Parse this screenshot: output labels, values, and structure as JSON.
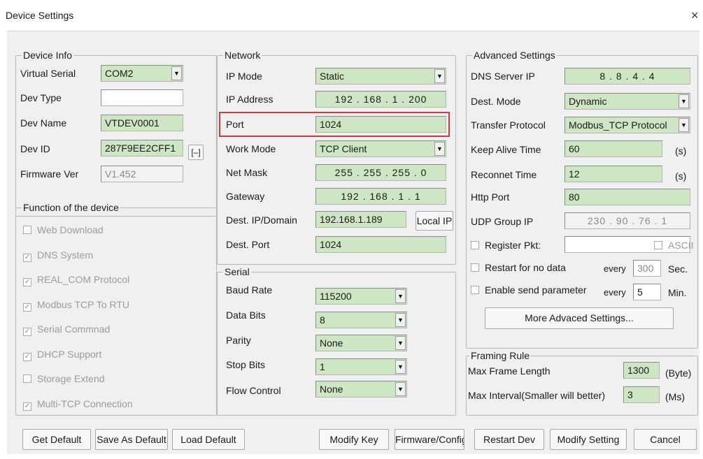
{
  "window": {
    "title": "Device Settings",
    "close_glyph": "×"
  },
  "device_info": {
    "legend": "Device Info",
    "virtual_serial_label": "Virtual Serial",
    "virtual_serial_value": "COM2",
    "dev_type_label": "Dev Type",
    "dev_type_value": "",
    "dev_name_label": "Dev Name",
    "dev_name_value": "VTDEV0001",
    "dev_id_label": "Dev ID",
    "dev_id_value": "287F9EE2CFF1",
    "dev_id_button": "[–]",
    "firmware_label": "Firmware Ver",
    "firmware_value": "V1.452"
  },
  "functions": {
    "legend": "Function of the device",
    "items": [
      {
        "label": "Web Download",
        "checked": false
      },
      {
        "label": "DNS System",
        "checked": true
      },
      {
        "label": "REAL_COM Protocol",
        "checked": true
      },
      {
        "label": "Modbus TCP To RTU",
        "checked": true
      },
      {
        "label": "Serial Commnad",
        "checked": true
      },
      {
        "label": "DHCP Support",
        "checked": true
      },
      {
        "label": "Storage Extend",
        "checked": false
      },
      {
        "label": "Multi-TCP Connection",
        "checked": true
      }
    ]
  },
  "network": {
    "legend": "Network",
    "ip_mode_label": "IP Mode",
    "ip_mode_value": "Static",
    "ip_address_label": "IP Address",
    "ip_address_value": "192 . 168 .  1  . 200",
    "port_label": "Port",
    "port_value": "1024",
    "work_mode_label": "Work Mode",
    "work_mode_value": "TCP Client",
    "net_mask_label": "Net Mask",
    "net_mask_value": "255 . 255 . 255 .  0",
    "gateway_label": "Gateway",
    "gateway_value": "192 . 168 .  1  .  1",
    "dest_ip_label": "Dest. IP/Domain",
    "dest_ip_value": "192.168.1.189",
    "local_ip_button": "Local IP",
    "dest_port_label": "Dest. Port",
    "dest_port_value": "1024"
  },
  "serial": {
    "legend": "Serial",
    "baud_label": "Baud Rate",
    "baud_value": "115200",
    "data_bits_label": "Data Bits",
    "data_bits_value": "8",
    "parity_label": "Parity",
    "parity_value": "None",
    "stop_bits_label": "Stop Bits",
    "stop_bits_value": "1",
    "flow_label": "Flow Control",
    "flow_value": "None"
  },
  "advanced": {
    "legend": "Advanced Settings",
    "dns_label": "DNS Server IP",
    "dns_value": "8  .  8  .  4  .  4",
    "dest_mode_label": "Dest. Mode",
    "dest_mode_value": "Dynamic",
    "transfer_label": "Transfer Protocol",
    "transfer_value": "Modbus_TCP Protocol",
    "keepalive_label": "Keep Alive Time",
    "keepalive_value": "60",
    "keepalive_unit": "(s)",
    "reconnect_label": "Reconnet Time",
    "reconnect_value": "12",
    "reconnect_unit": "(s)",
    "http_label": "Http Port",
    "http_value": "80",
    "udp_label": "UDP Group IP",
    "udp_value": "230 .  90  .  76  .  1",
    "register_label": "Register Pkt:",
    "register_value": "",
    "ascii_label": "ASCII",
    "restart_label": "Restart for no data",
    "restart_every": "every",
    "restart_value": "300",
    "restart_unit": "Sec.",
    "send_label": "Enable send parameter",
    "send_every": "every",
    "send_value": "5",
    "send_unit": "Min.",
    "more_button": "More Advaced Settings..."
  },
  "framing": {
    "legend": "Framing Rule",
    "max_len_label": "Max Frame Length",
    "max_len_value": "1300",
    "max_len_unit": "(Byte)",
    "max_int_label": "Max Interval(Smaller will better)",
    "max_int_value": "3",
    "max_int_unit": "(Ms)"
  },
  "buttons": {
    "get_default": "Get Default",
    "save_default": "Save As Default",
    "load_default": "Load Default",
    "modify_key": "Modify Key",
    "firmware_config": "Firmware/Config",
    "restart_dev": "Restart Dev",
    "modify_setting": "Modify Setting",
    "cancel": "Cancel"
  },
  "icons": {
    "dropdown": "▼",
    "check": "✓"
  },
  "colors": {
    "field_green": "#cfe6c4",
    "highlight_red": "#d43a3a",
    "dialog_gray": "#f0f0f0"
  }
}
